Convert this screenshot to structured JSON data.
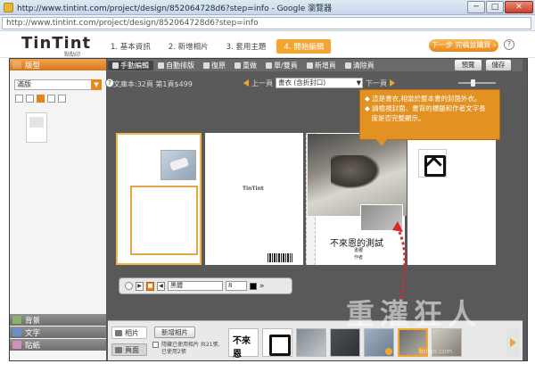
{
  "window": {
    "title": "http://www.tintint.com/project/design/852064728d6?step=info - Google 瀏覽器",
    "min_btn": "─",
    "max_btn": "□",
    "close_btn": "✕"
  },
  "address": {
    "url": "http://www.tintint.com/project/design/852064728d6?step=info"
  },
  "header": {
    "logo": "TinTint",
    "logo_sub": "點點印",
    "steps": [
      "1. 基本資訊",
      "2. 新增相片",
      "3. 套用主題",
      "4. 開始編輯"
    ],
    "active_step": 3,
    "next_label": "下一步 完稿並購買 ›",
    "help": "?"
  },
  "sidebar": {
    "layout_tab": "版型",
    "template_value": "滿版",
    "template_help": "?",
    "bottom_tabs": [
      "背景",
      "文字",
      "貼紙"
    ]
  },
  "toolbar": {
    "buttons": [
      "手動編輯",
      "自動排版",
      "復原",
      "重做",
      "單/雙頁",
      "新增頁",
      "清除頁"
    ],
    "preview": "預覽",
    "save": "儲存"
  },
  "infobar": {
    "info": "文庫本:32頁 第1頁$499",
    "prev": "上一頁",
    "page_value": "書衣 (含折封口)",
    "next": "下一頁"
  },
  "book": {
    "tintint_small": "TinTint",
    "cover_title": "不來恩的測試",
    "author1": "書腰",
    "author2": "作者"
  },
  "tooltip": {
    "lines": [
      "◆ 這是書衣,相當於整本書的封面外衣。",
      "◆ 請檢視封面、書背的標題和作者文字長",
      "　度是否完整顯示。"
    ]
  },
  "text_toolbar": {
    "font_value": "黑體",
    "size_value": "8",
    "more": "»"
  },
  "bottom": {
    "photos_tab": "相片",
    "pages_tab": "頁面",
    "add_photo": "新增相片",
    "hide_used": "隱藏已使用相片 共21張,已使用2張"
  },
  "watermark": {
    "main": "重灌狂人",
    "sub": "briian.com"
  }
}
